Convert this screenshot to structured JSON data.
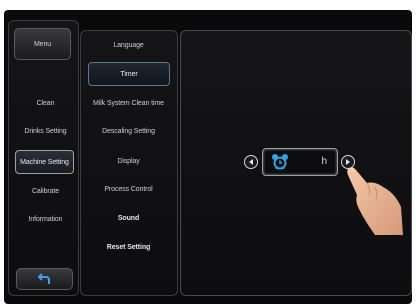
{
  "menu": {
    "label": "Menu"
  },
  "left_nav": [
    {
      "label": "Clean",
      "active": false
    },
    {
      "label": "Drinks Setting",
      "active": false
    },
    {
      "label": "Machine Setting",
      "active": true
    },
    {
      "label": "Calibrate",
      "active": false
    },
    {
      "label": "Information",
      "active": false
    }
  ],
  "middle_nav": [
    {
      "label": "Language",
      "active": false,
      "bold": false
    },
    {
      "label": "Timer",
      "active": true,
      "bold": false
    },
    {
      "label": "Milk System Clean time",
      "active": false,
      "bold": false
    },
    {
      "label": "Descaling Setting",
      "active": false,
      "bold": false
    },
    {
      "label": "Display",
      "active": false,
      "bold": false
    },
    {
      "label": "Process Control",
      "active": false,
      "bold": false
    },
    {
      "label": "Sound",
      "active": false,
      "bold": true
    },
    {
      "label": "Reset Setting",
      "active": false,
      "bold": true
    }
  ],
  "timer_setting": {
    "unit": "h",
    "icon": "alarm-clock-icon",
    "decrease_icon": "left-arrow-icon",
    "increase_icon": "right-arrow-icon"
  },
  "back": {
    "icon": "back-arrow-icon"
  },
  "colors": {
    "background": "#0a0a0b",
    "accent_blue": "#2fa6e6",
    "active_border": "#5d7891"
  }
}
